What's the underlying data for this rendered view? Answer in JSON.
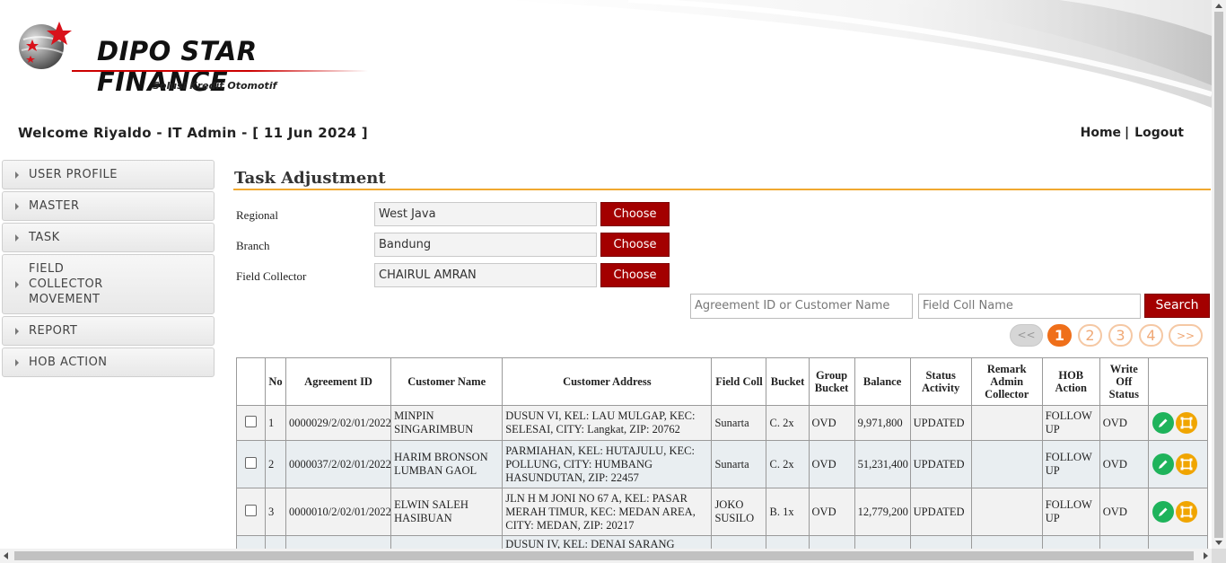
{
  "brand": {
    "name": "DIPO STAR FINANCE",
    "tagline": "Solusi Kredit Otomotif"
  },
  "header": {
    "welcome": "Welcome Riyaldo - IT Admin - [ 11 Jun 2024 ]",
    "home_link": "Home",
    "separator": "|",
    "logout_link": "Logout"
  },
  "sidebar": {
    "items": [
      {
        "label": "USER PROFILE"
      },
      {
        "label": "MASTER"
      },
      {
        "label": "TASK"
      },
      {
        "label": "FIELD COLLECTOR MOVEMENT"
      },
      {
        "label": "REPORT"
      },
      {
        "label": "HOB ACTION"
      }
    ]
  },
  "main": {
    "title": "Task Adjustment",
    "regional": {
      "label": "Regional",
      "value": "West Java",
      "button": "Choose"
    },
    "branch": {
      "label": "Branch",
      "value": "Bandung",
      "button": "Choose"
    },
    "field_collector": {
      "label": "Field Collector",
      "value": "CHAIRUL AMRAN",
      "button": "Choose"
    },
    "search": {
      "agreement_placeholder": "Agreement ID or Customer Name",
      "fieldcoll_placeholder": "Field Coll Name",
      "button": "Search"
    },
    "pagination": {
      "prev": "<<",
      "pages": [
        "1",
        "2",
        "3",
        "4"
      ],
      "current": "1",
      "next": ">>"
    },
    "table": {
      "columns": [
        "No",
        "Agreement ID",
        "Customer Name",
        "Customer Address",
        "Field Coll",
        "Bucket",
        "Group Bucket",
        "Balance",
        "Status Activity",
        "Remark Admin Collector",
        "HOB Action",
        "Write Off Status"
      ],
      "rows": [
        {
          "no": "1",
          "agreement_id": "0000029/2/02/01/2022",
          "customer_name": "MINPIN SINGARIMBUN",
          "address": "DUSUN VI, KEL: LAU MULGAP, KEC: SELESAI, CITY: Langkat, ZIP: 20762",
          "field_coll": "Sunarta",
          "bucket": "C. 2x",
          "group_bucket": "OVD",
          "balance": "9,971,800",
          "status_activity": "UPDATED",
          "remark": "",
          "hob_action": "FOLLOW UP",
          "write_off": "OVD"
        },
        {
          "no": "2",
          "agreement_id": "0000037/2/02/01/2022",
          "customer_name": "HARIM BRONSON LUMBAN GAOL",
          "address": "PARMIAHAN, KEL: HUTAJULU, KEC: POLLUNG, CITY: HUMBANG HASUNDUTAN, ZIP: 22457",
          "field_coll": "Sunarta",
          "bucket": "C. 2x",
          "group_bucket": "OVD",
          "balance": "51,231,400",
          "status_activity": "UPDATED",
          "remark": "",
          "hob_action": "FOLLOW UP",
          "write_off": "OVD"
        },
        {
          "no": "3",
          "agreement_id": "0000010/2/02/01/2022",
          "customer_name": "ELWIN SALEH HASIBUAN",
          "address": "JLN H M JONI NO 67 A, KEL: PASAR MERAH TIMUR, KEC: MEDAN AREA, CITY: MEDAN, ZIP: 20217",
          "field_coll": "JOKO SUSILO",
          "bucket": "B. 1x",
          "group_bucket": "OVD",
          "balance": "12,779,200",
          "status_activity": "UPDATED",
          "remark": "",
          "hob_action": "FOLLOW UP",
          "write_off": "OVD"
        },
        {
          "no": "",
          "agreement_id": "",
          "customer_name": "",
          "address": "DUSUN IV, KEL: DENAI SARANG",
          "field_coll": "",
          "bucket": "",
          "group_bucket": "",
          "balance": "",
          "status_activity": "",
          "remark": "",
          "hob_action": "",
          "write_off": ""
        }
      ]
    }
  },
  "colors": {
    "accent_red": "#a30000",
    "title_rule": "#f0a830",
    "page_active": "#ef6f1a",
    "edit_icon": "#1eb35b",
    "move_icon": "#f0a500"
  },
  "icons": [
    "logo-globe-star-icon",
    "edit-pencil-icon",
    "move-icon",
    "chevron-right-icon"
  ]
}
